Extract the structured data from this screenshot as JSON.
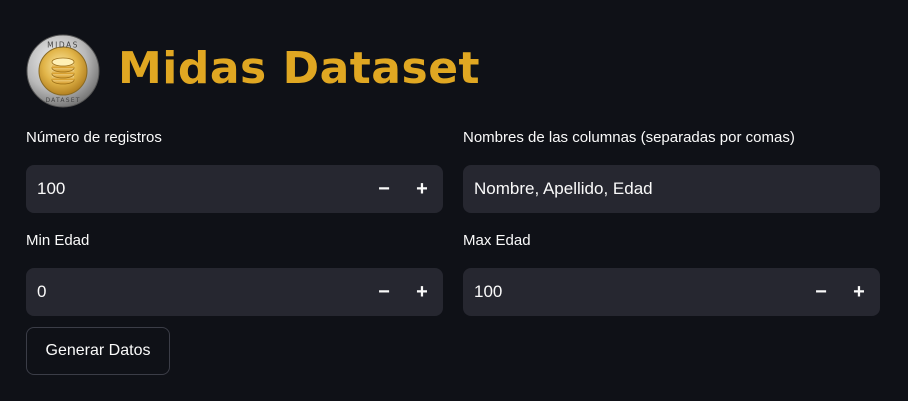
{
  "header": {
    "title": "Midas Dataset",
    "logo_icon": "midas-dataset-coin-logo",
    "logo_text_top": "MIDAS",
    "logo_text_bottom": "DATASET"
  },
  "colors": {
    "background": "#0f1117",
    "input_background": "#262730",
    "title": "#e0a722",
    "text": "#fafafa"
  },
  "fields": {
    "num_records": {
      "label": "Número de registros",
      "value": "100",
      "minus": "−",
      "plus": "+"
    },
    "column_names": {
      "label": "Nombres de las columnas (separadas por comas)",
      "value": "Nombre, Apellido, Edad"
    },
    "min_age": {
      "label": "Min Edad",
      "value": "0",
      "minus": "−",
      "plus": "+"
    },
    "max_age": {
      "label": "Max Edad",
      "value": "100",
      "minus": "−",
      "plus": "+"
    }
  },
  "actions": {
    "generate_label": "Generar Datos"
  }
}
